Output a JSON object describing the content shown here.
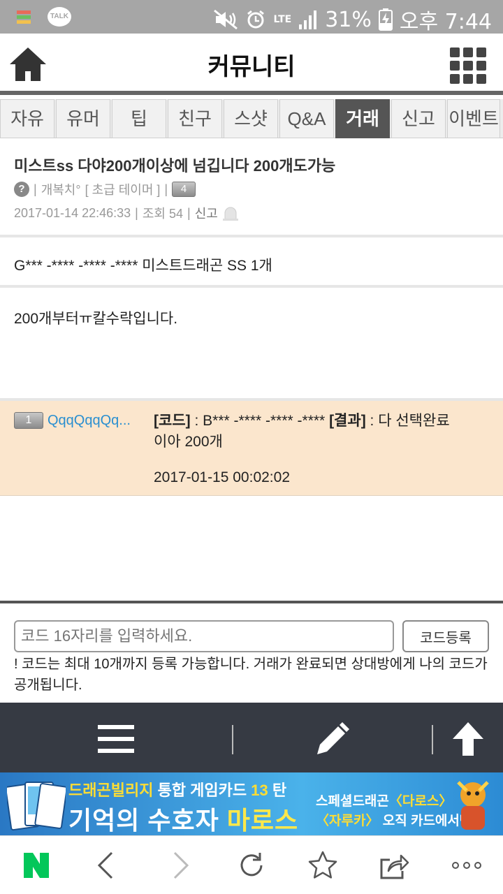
{
  "status_bar": {
    "battery": "31%",
    "time": "오후 7:44",
    "lte": "LTE",
    "talk": "TALK"
  },
  "app": {
    "title": "커뮤니티"
  },
  "tabs": [
    {
      "label": "자유"
    },
    {
      "label": "유머"
    },
    {
      "label": "팁"
    },
    {
      "label": "친구"
    },
    {
      "label": "스샷"
    },
    {
      "label": "Q&A"
    },
    {
      "label": "거래",
      "active": true
    },
    {
      "label": "신고"
    },
    {
      "label": "이벤트"
    }
  ],
  "post": {
    "title": "미스트ss 다야200개이상에 넘깁니다 200개도가능",
    "author_icon": "?",
    "author": "개복치°",
    "rank": "[ 초급 테이머 ]",
    "level": "4",
    "datetime": "2017-01-14 22:46:33",
    "views": "조회 54",
    "report": "신고",
    "code_line": "G*** -**** -**** -**** 미스트드래곤 SS 1개",
    "body": "200개부터ㅠ칼수락입니다."
  },
  "reply": {
    "level": "1",
    "name": "QqqQqqQq...",
    "code_label": "[코드]",
    "code_value": " : B*** -**** -**** -**** ",
    "result_label": "[결과]",
    "result_value": " : 다  선택완료",
    "text": "이아 200개",
    "datetime": "2017-01-15 00:02:02"
  },
  "input": {
    "placeholder": "코드 16자리를 입력하세요.",
    "submit_label": "코드등록",
    "notice": "! 코드는 최대 10개까지 등록 가능합니다. 거래가 완료되면 상대방에게 나의 코드가 공개됩니다."
  },
  "banner": {
    "line1_a": "드래곤빌리지",
    "line1_b": " 통합 게임카드 ",
    "line1_c": "13",
    "line1_d": " 탄",
    "main_a": "기억의 수호자 ",
    "main_b": "마로스",
    "side1_a": "스페셜드래곤",
    "side1_b": "〈다로스〉",
    "side2_a": "〈자루카〉",
    "side2_b": " 오직 카드에서만!"
  },
  "colors": {
    "toolbar_bg": "#363a43",
    "reply_bg": "#fbe6cd",
    "active_tab_bg": "#555555",
    "link": "#2a8fd0",
    "naver_green": "#03c75a"
  }
}
